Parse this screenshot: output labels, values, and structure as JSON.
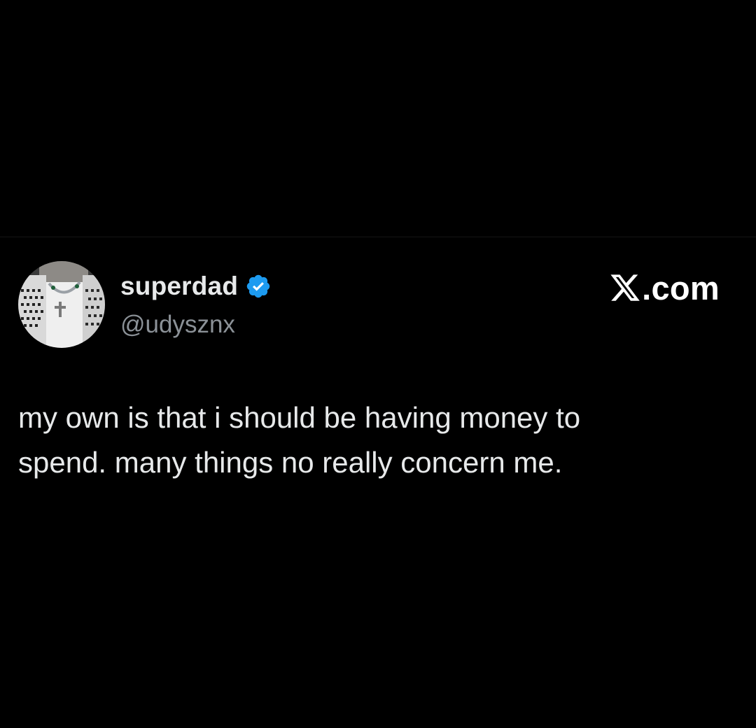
{
  "author": {
    "display_name": "superdad",
    "handle": "@udysznx",
    "verified": true,
    "verified_icon": "verified-badge-icon",
    "avatar_icon": "avatar-photo"
  },
  "brand": {
    "logo_icon": "x-logo-icon",
    "domain_text": ".com"
  },
  "tweet": {
    "text": "my own is that i should be having money to\nspend. many things no really concern me."
  },
  "colors": {
    "background": "#000000",
    "primary_text": "#e7e9ea",
    "secondary_text": "#8b9197",
    "verified_blue": "#1d9bf0",
    "logo_white": "#ffffff"
  }
}
